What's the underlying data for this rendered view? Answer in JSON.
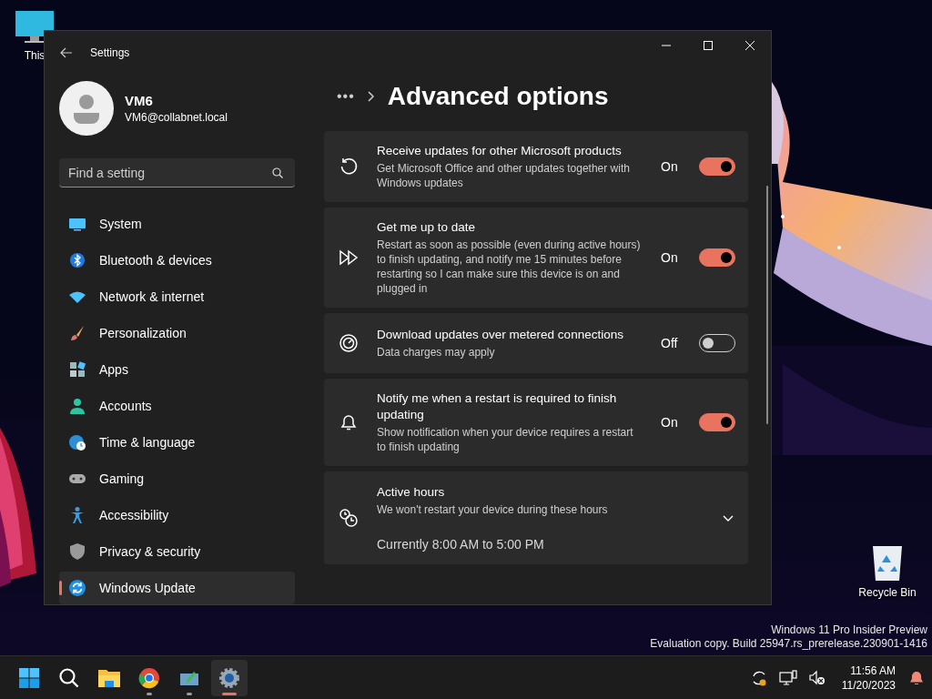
{
  "desktop": {
    "icons": [
      {
        "label": "This"
      },
      {
        "label": "Recycle Bin"
      }
    ],
    "watermark": [
      "Windows 11 Pro Insider Preview",
      "Evaluation copy. Build 25947.rs_prerelease.230901-1416"
    ]
  },
  "window": {
    "title": "Settings",
    "user": {
      "name": "VM6",
      "email": "VM6@collabnet.local"
    },
    "search": {
      "placeholder": "Find a setting"
    },
    "nav": [
      {
        "label": "System",
        "selected": false
      },
      {
        "label": "Bluetooth & devices",
        "selected": false
      },
      {
        "label": "Network & internet",
        "selected": false
      },
      {
        "label": "Personalization",
        "selected": false
      },
      {
        "label": "Apps",
        "selected": false
      },
      {
        "label": "Accounts",
        "selected": false
      },
      {
        "label": "Time & language",
        "selected": false
      },
      {
        "label": "Gaming",
        "selected": false
      },
      {
        "label": "Accessibility",
        "selected": false
      },
      {
        "label": "Privacy & security",
        "selected": false
      },
      {
        "label": "Windows Update",
        "selected": true
      }
    ],
    "breadcrumb": "•••",
    "page_title": "Advanced options",
    "settings": [
      {
        "kind": "toggle",
        "title": "Receive updates for other Microsoft products",
        "description": "Get Microsoft Office and other updates together with Windows updates",
        "state_label": "On",
        "on": true
      },
      {
        "kind": "toggle",
        "title": "Get me up to date",
        "description": "Restart as soon as possible (even during active hours) to finish updating, and notify me 15 minutes before restarting so I can make sure this device is on and plugged in",
        "state_label": "On",
        "on": true
      },
      {
        "kind": "toggle",
        "title": "Download updates over metered connections",
        "description": "Data charges may apply",
        "state_label": "Off",
        "on": false
      },
      {
        "kind": "toggle",
        "title": "Notify me when a restart is required to finish updating",
        "description": "Show notification when your device requires a restart to finish updating",
        "state_label": "On",
        "on": true
      },
      {
        "kind": "expander",
        "title": "Active hours",
        "description": "We won't restart your device during these hours",
        "detail": "Currently 8:00 AM to 5:00 PM",
        "expanded": false
      }
    ]
  },
  "taskbar": {
    "apps": [
      {
        "running": false,
        "active": false
      },
      {
        "running": false,
        "active": false
      },
      {
        "running": false,
        "active": false
      },
      {
        "running": true,
        "active": false
      },
      {
        "running": true,
        "active": false
      },
      {
        "running": true,
        "active": true
      }
    ],
    "clock": {
      "time": "11:56 AM",
      "date": "11/20/2023"
    }
  }
}
